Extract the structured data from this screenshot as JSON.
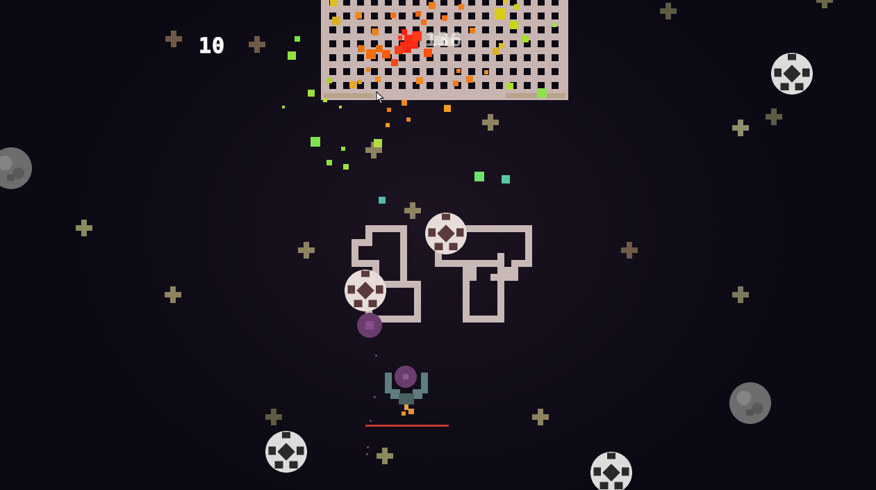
{
  "hud": {
    "score": "10",
    "goal_counter": "136",
    "wave_number": "17"
  },
  "colors": {
    "background": "#0b0913",
    "goal_net": "#c8b4b0",
    "goal_post": "#b8a48c",
    "wave_digits": "#c8b8b6",
    "player_hull": "#5f7d80",
    "player_core": "#6a3d6e",
    "health_bar": "#c0392b"
  },
  "icons": {
    "player": "spaceship-icon",
    "ball": "soccer-ball-icon",
    "rock": "asteroid-icon",
    "star": "plus-star-icon",
    "cursor": "mouse-cursor-icon"
  }
}
